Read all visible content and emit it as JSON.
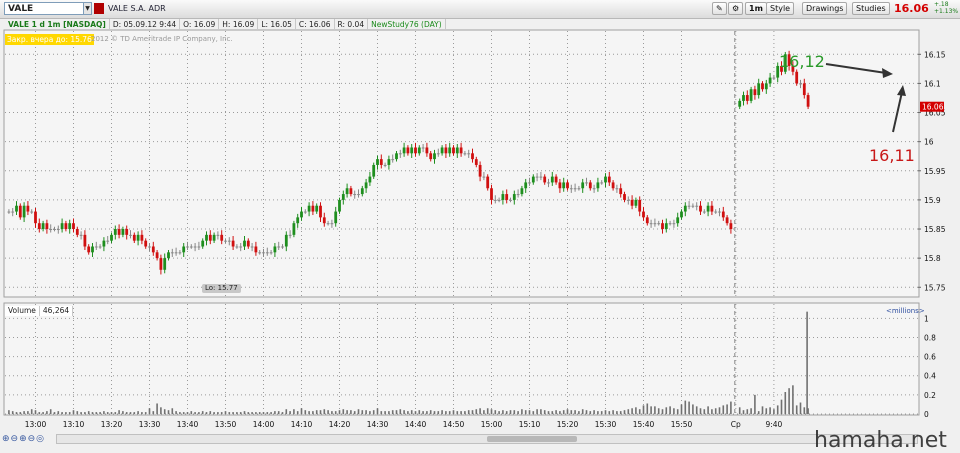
{
  "toolbar": {
    "symbol": "VALE",
    "company": "VALE S.A. ADR",
    "buttons": [
      "1m",
      "Style",
      "Drawings",
      "Studies"
    ],
    "last_price": "16.06",
    "change_abs": "+.18",
    "change_pct": "+1.13%"
  },
  "infobar": {
    "symbol_line": "VALE 1 d 1m [NASDAQ]",
    "date": "D: 05.09.12 9:44",
    "open": "O: 16.09",
    "high": "H: 16.09",
    "low": "L: 16.05",
    "close": "C: 16.06",
    "range": "R: 0.04",
    "study": "NewStudy76 (DAY)"
  },
  "badge": "Закр. вчера до: 15.76",
  "copyright": "2012 © TD Ameritrade IP Company, Inc.",
  "volume_panel": {
    "label": "Volume",
    "value": "46,264",
    "units": "<millions>"
  },
  "annotations": {
    "a1": "16,12",
    "a2": "16,11",
    "lo": "Lo: 15.77"
  },
  "watermark": "hamaha.net",
  "colors": {
    "up": "#1e8e1e",
    "down": "#d01010",
    "price_tag": "#d40000"
  },
  "chart_data": {
    "type": "candlestick",
    "price_axis_ticks": [
      "16.15",
      "16.1",
      "16.05",
      "16",
      "15.95",
      "15.9",
      "15.85",
      "15.8",
      "15.75"
    ],
    "volume_axis_ticks": [
      "1",
      "0.8",
      "0.6",
      "0.4",
      "0.2",
      "0"
    ],
    "x_tick_labels": [
      "13:00",
      "13:10",
      "13:20",
      "13:30",
      "13:40",
      "13:50",
      "14:00",
      "14:10",
      "14:20",
      "14:30",
      "14:40",
      "14:50",
      "15:00",
      "15:10",
      "15:20",
      "15:30",
      "15:40",
      "15:50",
      "Ср",
      "9:40"
    ],
    "ylim": [
      15.735,
      16.19
    ],
    "vol_ylim": [
      0,
      1.15
    ],
    "grid": true,
    "session_prev": {
      "start": "12:53",
      "closes": [
        15.88,
        15.88,
        15.89,
        15.87,
        15.89,
        15.88,
        15.88,
        15.86,
        15.85,
        15.86,
        15.85,
        15.85,
        15.85,
        15.85,
        15.86,
        15.85,
        15.86,
        15.85,
        15.84,
        15.84,
        15.82,
        15.81,
        15.82,
        15.82,
        15.82,
        15.83,
        15.83,
        15.84,
        15.85,
        15.84,
        15.85,
        15.84,
        15.84,
        15.83,
        15.84,
        15.83,
        15.82,
        15.82,
        15.81,
        15.8,
        15.78,
        15.8,
        15.81,
        15.81,
        15.81,
        15.81,
        15.82,
        15.82,
        15.82,
        15.82,
        15.82,
        15.83,
        15.84,
        15.83,
        15.84,
        15.84,
        15.83,
        15.83,
        15.83,
        15.82,
        15.82,
        15.82,
        15.83,
        15.82,
        15.82,
        15.81,
        15.81,
        15.81,
        15.81,
        15.81,
        15.82,
        15.82,
        15.82,
        15.84,
        15.84,
        15.86,
        15.87,
        15.88,
        15.88,
        15.89,
        15.88,
        15.89,
        15.87,
        15.86,
        15.86,
        15.86,
        15.88,
        15.9,
        15.91,
        15.92,
        15.91,
        15.91,
        15.91,
        15.92,
        15.93,
        15.94,
        15.96,
        15.97,
        15.96,
        15.96,
        15.97,
        15.97,
        15.98,
        15.98,
        15.99,
        15.98,
        15.99,
        15.98,
        15.99,
        15.99,
        15.98,
        15.97,
        15.98,
        15.98,
        15.99,
        15.98,
        15.99,
        15.98,
        15.99,
        15.98,
        15.98,
        15.98,
        15.97,
        15.96,
        15.94,
        15.94,
        15.92,
        15.9,
        15.9,
        15.9,
        15.91,
        15.9,
        15.9,
        15.91,
        15.91,
        15.92,
        15.93,
        15.93,
        15.94,
        15.94,
        15.94,
        15.93,
        15.93,
        15.94,
        15.93,
        15.92,
        15.93,
        15.92,
        15.92,
        15.92,
        15.92,
        15.93,
        15.93,
        15.92,
        15.92,
        15.93,
        15.93,
        15.94,
        15.93,
        15.92,
        15.92,
        15.91,
        15.9,
        15.9,
        15.89,
        15.9,
        15.88,
        15.87,
        15.86,
        15.86,
        15.86,
        15.86,
        15.85,
        15.86,
        15.86,
        15.86,
        15.87,
        15.88,
        15.89,
        15.89,
        15.89,
        15.89,
        15.88,
        15.88,
        15.89,
        15.88,
        15.88,
        15.88,
        15.87,
        15.86,
        15.85
      ],
      "volumes": [
        0.04,
        0.03,
        0.02,
        0.02,
        0.03,
        0.03,
        0.05,
        0.04,
        0.02,
        0.02,
        0.03,
        0.05,
        0.02,
        0.03,
        0.02,
        0.02,
        0.02,
        0.04,
        0.03,
        0.02,
        0.02,
        0.03,
        0.02,
        0.02,
        0.02,
        0.03,
        0.02,
        0.02,
        0.02,
        0.04,
        0.03,
        0.02,
        0.02,
        0.02,
        0.03,
        0.02,
        0.02,
        0.06,
        0.03,
        0.11,
        0.07,
        0.05,
        0.04,
        0.06,
        0.03,
        0.02,
        0.02,
        0.02,
        0.03,
        0.02,
        0.02,
        0.03,
        0.02,
        0.03,
        0.02,
        0.02,
        0.02,
        0.03,
        0.02,
        0.02,
        0.02,
        0.02,
        0.03,
        0.02,
        0.02,
        0.02,
        0.02,
        0.02,
        0.02,
        0.02,
        0.03,
        0.03,
        0.02,
        0.05,
        0.03,
        0.05,
        0.03,
        0.06,
        0.04,
        0.03,
        0.03,
        0.04,
        0.04,
        0.05,
        0.04,
        0.03,
        0.03,
        0.04,
        0.05,
        0.04,
        0.04,
        0.03,
        0.05,
        0.04,
        0.04,
        0.03,
        0.04,
        0.06,
        0.03,
        0.03,
        0.03,
        0.04,
        0.04,
        0.05,
        0.04,
        0.03,
        0.04,
        0.03,
        0.04,
        0.03,
        0.03,
        0.04,
        0.03,
        0.03,
        0.04,
        0.03,
        0.03,
        0.04,
        0.03,
        0.03,
        0.03,
        0.04,
        0.04,
        0.05,
        0.06,
        0.04,
        0.06,
        0.05,
        0.04,
        0.03,
        0.04,
        0.03,
        0.04,
        0.04,
        0.03,
        0.05,
        0.04,
        0.04,
        0.03,
        0.05,
        0.05,
        0.04,
        0.03,
        0.03,
        0.04,
        0.03,
        0.04,
        0.05,
        0.04,
        0.04,
        0.03,
        0.05,
        0.04,
        0.03,
        0.04,
        0.03,
        0.03,
        0.04,
        0.03,
        0.04,
        0.03,
        0.03,
        0.04,
        0.05,
        0.06,
        0.07,
        0.05,
        0.09,
        0.11,
        0.08,
        0.08,
        0.06,
        0.05,
        0.07,
        0.08,
        0.06,
        0.05,
        0.1,
        0.14,
        0.13,
        0.1,
        0.08,
        0.06,
        0.05,
        0.08,
        0.05,
        0.06,
        0.07,
        0.09,
        0.1,
        0.13,
        0.09
      ]
    },
    "session_today": {
      "start": "9:31",
      "closes": [
        16.07,
        16.08,
        16.07,
        16.09,
        16.08,
        16.1,
        16.09,
        16.1,
        16.11,
        16.11,
        16.13,
        16.12,
        16.15,
        16.13,
        16.12,
        16.1,
        16.1,
        16.08,
        16.06
      ],
      "volumes": [
        0.07,
        0.04,
        0.05,
        0.06,
        0.2,
        0.03,
        0.08,
        0.06,
        0.07,
        0.05,
        0.09,
        0.15,
        0.23,
        0.27,
        0.3,
        0.09,
        0.12,
        0.07,
        0.06
      ],
      "extra_volume_spike": 1.07
    }
  }
}
